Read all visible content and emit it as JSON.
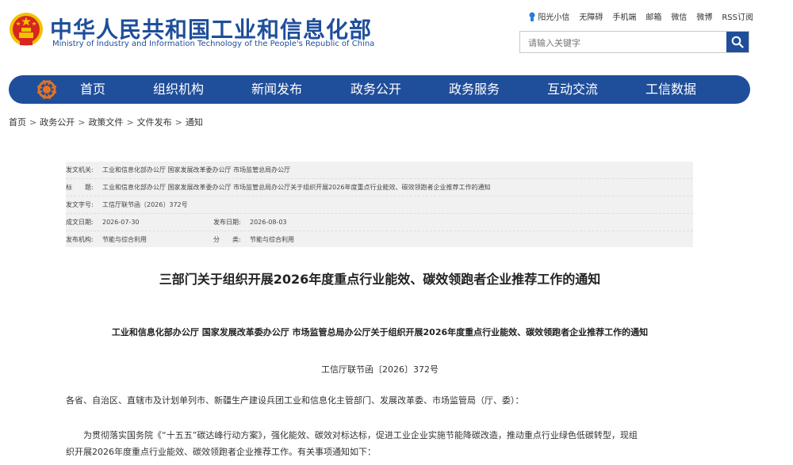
{
  "header": {
    "title": "中华人民共和国工业和信息化部",
    "subtitle": "Ministry of Industry and Information Technology of the People's Republic of China",
    "top_links": [
      "阳光小信",
      "无障碍",
      "手机端",
      "邮箱",
      "微信",
      "微博",
      "RSS订阅"
    ],
    "search_placeholder": "请输入关键字"
  },
  "nav": {
    "items": [
      "首页",
      "组织机构",
      "新闻发布",
      "政务公开",
      "政务服务",
      "互动交流",
      "工信数据"
    ]
  },
  "breadcrumb": [
    "首页",
    "政务公开",
    "政策文件",
    "文件发布",
    "通知"
  ],
  "meta": {
    "issuer_label": "发文机关:",
    "issuer": "工业和信息化部办公厅 国家发展改革委办公厅 市场监管总局办公厅",
    "title_label": "标　　题:",
    "title": "工业和信息化部办公厅 国家发展改革委办公厅 市场监管总局办公厅关于组织开展2026年度重点行业能效、碳效领跑者企业推荐工作的通知",
    "docno_label": "发文字号:",
    "docno": "工信厅联节函〔2026〕372号",
    "created_label": "成文日期:",
    "created": "2026-07-30",
    "published_label": "发布日期:",
    "published": "2026-08-03",
    "agency_label": "发布机构:",
    "agency": "节能与综合利用",
    "category_label": "分　　类:",
    "category": "节能与综合利用"
  },
  "doc": {
    "title": "三部门关于组织开展2026年度重点行业能效、碳效领跑者企业推荐工作的通知",
    "subtitle": "工业和信息化部办公厅  国家发展改革委办公厅  市场监管总局办公厅关于组织开展2026年度重点行业能效、碳效领跑者企业推荐工作的通知",
    "number": "工信厅联节函〔2026〕372号",
    "addressee": "各省、自治区、直辖市及计划单列市、新疆生产建设兵团工业和信息化主管部门、发展改革委、市场监管局（厅、委）：",
    "para1_line1": "　　为贯彻落实国务院《“十五五”碳达峰行动方案》，强化能效、碳效对标达标，促进工业企业实施节能降碳改造，推动重点行业绿色低碳转型，现组",
    "para1_line2": "织开展2026年度重点行业能效、碳效领跑者企业推荐工作。有关事项通知如下："
  },
  "colors": {
    "brand": "#1f4e9b",
    "emblem_red": "#d7261e",
    "emblem_gold": "#f2c200"
  }
}
